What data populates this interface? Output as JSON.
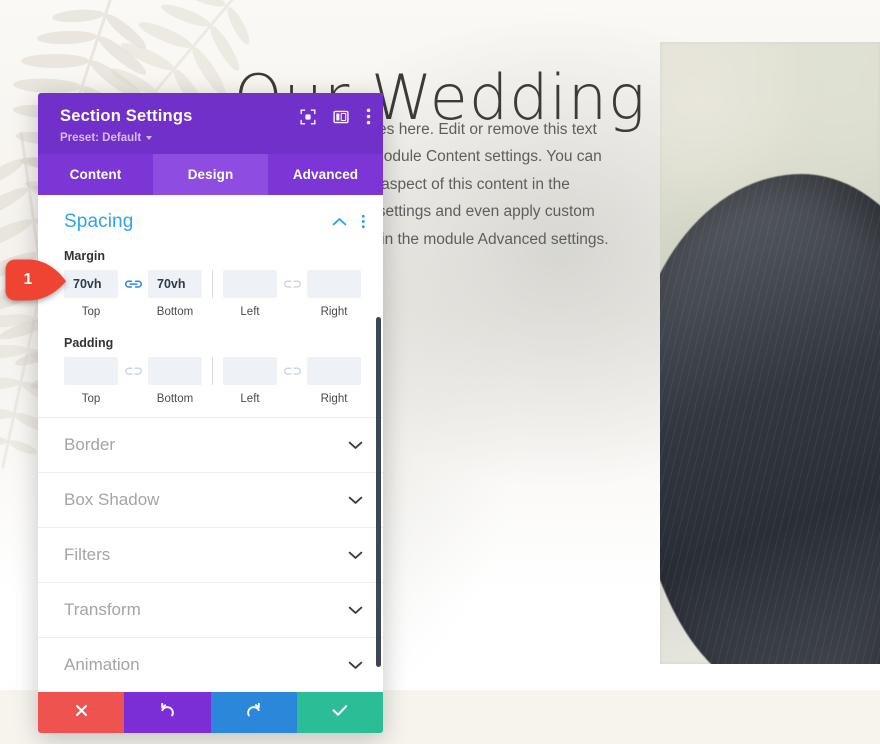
{
  "website": {
    "hero_title": "Our Wedding",
    "hero_paragraph": "Your content goes here. Edit or remove this text inline or in the module Content settings. You can also style every aspect of this content in the module Design settings and even apply custom CSS to this text in the module Advanced settings."
  },
  "modal": {
    "title": "Section Settings",
    "preset_label": "Preset: Default",
    "header_icons": [
      {
        "name": "focus-icon",
        "title": "Expand / Focus"
      },
      {
        "name": "layout-icon",
        "title": "Panel Layout"
      },
      {
        "name": "more-options-icon",
        "title": "More Options"
      }
    ],
    "tabs": [
      {
        "label": "Content",
        "active": false
      },
      {
        "label": "Design",
        "active": true
      },
      {
        "label": "Advanced",
        "active": false
      }
    ],
    "spacing": {
      "group_title": "Spacing",
      "collapse_icon": "chevron-up-icon",
      "options_icon": "more-options-icon",
      "margin": {
        "label": "Margin",
        "linked_top_bottom": true,
        "linked_left_right": false,
        "fields": [
          {
            "caption": "Top",
            "value": "70vh"
          },
          {
            "caption": "Bottom",
            "value": "70vh"
          },
          {
            "caption": "Left",
            "value": ""
          },
          {
            "caption": "Right",
            "value": ""
          }
        ]
      },
      "padding": {
        "label": "Padding",
        "linked_top_bottom": false,
        "linked_left_right": false,
        "fields": [
          {
            "caption": "Top",
            "value": ""
          },
          {
            "caption": "Bottom",
            "value": ""
          },
          {
            "caption": "Left",
            "value": ""
          },
          {
            "caption": "Right",
            "value": ""
          }
        ]
      }
    },
    "collapsed_groups": [
      {
        "label": "Border"
      },
      {
        "label": "Box Shadow"
      },
      {
        "label": "Filters"
      },
      {
        "label": "Transform"
      },
      {
        "label": "Animation"
      }
    ],
    "footer_buttons": [
      {
        "name": "cancel-button",
        "icon": "close-icon",
        "color": "#ef5350"
      },
      {
        "name": "undo-button",
        "icon": "undo-icon",
        "color": "#7b2ed6"
      },
      {
        "name": "redo-button",
        "icon": "redo-icon",
        "color": "#2b87da"
      },
      {
        "name": "save-button",
        "icon": "checkmark-icon",
        "color": "#2bbd96"
      }
    ]
  },
  "annotations": [
    {
      "number": "1",
      "color": "#ef4433"
    }
  ],
  "colors": {
    "header_purple": "#7130c9",
    "tab_purple": "#7d36d6",
    "tab_active_purple": "#8f4ce0",
    "accent_blue": "#2ea3f2",
    "field_bg": "#eef1f6"
  }
}
